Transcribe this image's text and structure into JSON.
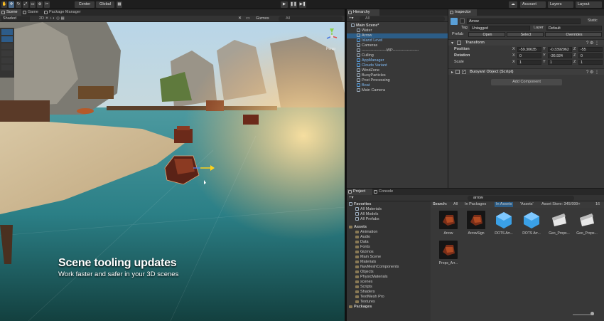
{
  "toolbar": {
    "center": "Center",
    "global": "Global",
    "account": "Account",
    "layers": "Layers",
    "layout": "Layout"
  },
  "scene": {
    "tabs": [
      "Scene",
      "Game",
      "Package Manager"
    ],
    "shaded": "Shaded",
    "persp": "Persp",
    "gizmos": "Gizmos",
    "search_all": "All",
    "overlay_title": "Scene tooling updates",
    "overlay_subtitle": "Work faster and safer in your 3D scenes"
  },
  "hierarchy": {
    "tab": "Hierarchy",
    "search_all": "All",
    "items": [
      {
        "label": "Main Scene*",
        "depth": 0,
        "icon": "scene-icon",
        "selected": false,
        "bold": true
      },
      {
        "label": "Water",
        "depth": 1,
        "icon": "gameobject-icon"
      },
      {
        "label": "Arrow",
        "depth": 1,
        "icon": "prefab-icon",
        "selected": true
      },
      {
        "label": "Island Level",
        "depth": 1,
        "icon": "prefab-icon",
        "blue": true
      },
      {
        "label": "Cameras",
        "depth": 1,
        "icon": "gameobject-icon"
      },
      {
        "label": "-------------------WP--------------------",
        "depth": 1,
        "icon": "gameobject-icon"
      },
      {
        "label": "Culling",
        "depth": 1,
        "icon": "gameobject-icon"
      },
      {
        "label": "AppManager",
        "depth": 1,
        "icon": "prefab-icon",
        "blue": true
      },
      {
        "label": "Clouds Variant",
        "depth": 1,
        "icon": "prefab-icon",
        "blue": true
      },
      {
        "label": "WindZone",
        "depth": 1,
        "icon": "gameobject-icon"
      },
      {
        "label": "BuoyParticles",
        "depth": 1,
        "icon": "gameobject-icon"
      },
      {
        "label": "Post Processing",
        "depth": 1,
        "icon": "gameobject-icon"
      },
      {
        "label": "Boat",
        "depth": 1,
        "icon": "prefab-icon",
        "blue": true
      },
      {
        "label": "Main Camera",
        "depth": 1,
        "icon": "camera-icon"
      }
    ]
  },
  "inspector": {
    "tab": "Inspector",
    "object_name": "Arrow",
    "static_label": "Static",
    "tag_label": "Tag",
    "tag_value": "Untagged",
    "layer_label": "Layer",
    "layer_value": "Default",
    "prefab_label": "Prefab",
    "open": "Open",
    "select": "Select",
    "overrides": "Overrides",
    "transform_title": "Transform",
    "position_label": "Position",
    "rotation_label": "Rotation",
    "scale_label": "Scale",
    "position": {
      "x": "-59.30635",
      "y": "-0.3392962",
      "z": "-55"
    },
    "rotation": {
      "x": "0",
      "y": "-36.924",
      "z": "0"
    },
    "scale": {
      "x": "1",
      "y": "1",
      "z": "1"
    },
    "axis_x": "X",
    "axis_y": "Y",
    "axis_z": "Z",
    "component_title": "Buoyant Object (Script)",
    "add_component": "Add Component"
  },
  "project": {
    "tabs": [
      "Project",
      "Console"
    ],
    "search_value": "arrow",
    "search_label": "Search:",
    "filters": [
      "All",
      "In Packages",
      "In Assets",
      "'Assets'",
      "Asset Store: 345/999+"
    ],
    "favorites_title": "Favorites",
    "favorites": [
      "All Materials",
      "All Models",
      "All Prefabs"
    ],
    "assets_title": "Assets",
    "folders": [
      "Animation",
      "Audio",
      "Data",
      "Fonts",
      "Gizmos",
      "Main Scene",
      "Materials",
      "NavMeshComponents",
      "Objects",
      "PhysicMaterials",
      "scenes",
      "Scripts",
      "Shaders",
      "TextMesh Pro",
      "Textures"
    ],
    "packages_title": "Packages",
    "asset_items": [
      {
        "label": "Arrow",
        "kind": "arrow"
      },
      {
        "label": "ArrowSign",
        "kind": "arrow"
      },
      {
        "label": "DOTS Arr...",
        "kind": "cube"
      },
      {
        "label": "DOTS Arr...",
        "kind": "cube"
      },
      {
        "label": "Geo_Props...",
        "kind": "geo"
      },
      {
        "label": "Geo_Props...",
        "kind": "geo"
      },
      {
        "label": "Props_Arr...",
        "kind": "arrow"
      }
    ],
    "count": "16"
  }
}
